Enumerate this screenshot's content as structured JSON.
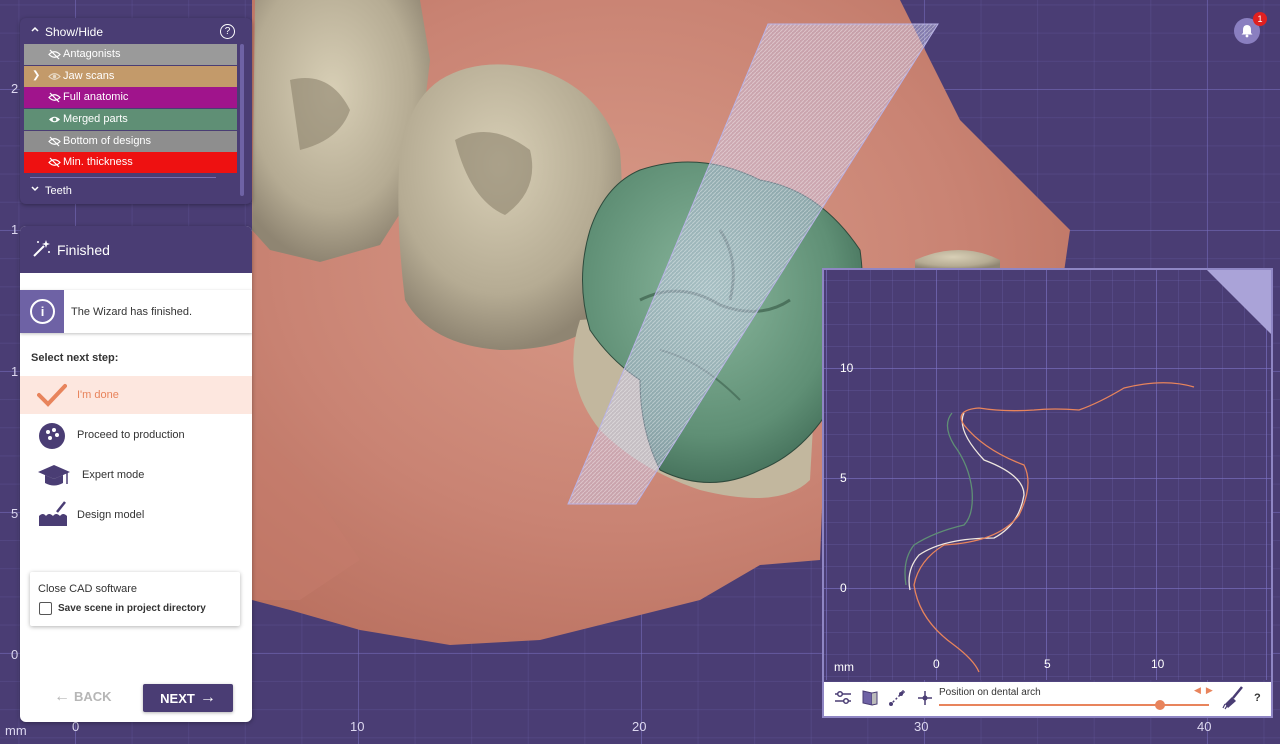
{
  "viewport": {
    "y_axis_labels": [
      "2",
      "1",
      "1",
      "5",
      "0"
    ],
    "x_axis_labels": [
      "mm",
      "0",
      "10",
      "20",
      "30",
      "40"
    ]
  },
  "notification": {
    "count": "1",
    "icon": "bell-icon"
  },
  "show_hide": {
    "title": "Show/Hide",
    "help": "?",
    "items": [
      {
        "label": "Antagonists",
        "color": "#9a9a9a",
        "icon": "eye-off-icon"
      },
      {
        "label": "Jaw scans",
        "color": "#c39a6a",
        "icon": "eye-icon"
      },
      {
        "label": "Full anatomic",
        "color": "#a0148c",
        "icon": "eye-off-icon"
      },
      {
        "label": "Merged parts",
        "color": "#5f8f75",
        "icon": "eye-icon"
      },
      {
        "label": "Bottom of designs",
        "color": "#8e8e8e",
        "icon": "eye-off-icon"
      },
      {
        "label": "Min. thickness",
        "color": "#ee1111",
        "icon": "eye-off-icon"
      }
    ],
    "teeth_label": "Teeth"
  },
  "wizard": {
    "title": "Finished",
    "info": "The Wizard has finished.",
    "select_label": "Select next step:",
    "steps": [
      {
        "label": "I'm done",
        "icon": "checkmark-icon"
      },
      {
        "label": "Proceed to production",
        "icon": "production-icon"
      },
      {
        "label": "Expert mode",
        "icon": "graduation-cap-icon"
      },
      {
        "label": "Design model",
        "icon": "design-model-icon"
      }
    ],
    "close_title": "Close CAD software",
    "save_label": "Save scene in project directory",
    "back": "BACK",
    "next": "NEXT"
  },
  "cross_section": {
    "y_labels": [
      "10",
      "5",
      "0"
    ],
    "x_labels": [
      "0",
      "5",
      "10"
    ],
    "unit": "mm",
    "position_label": "Position on dental arch",
    "position_value": 0.82,
    "help": "?",
    "accent": "#e8845c"
  }
}
